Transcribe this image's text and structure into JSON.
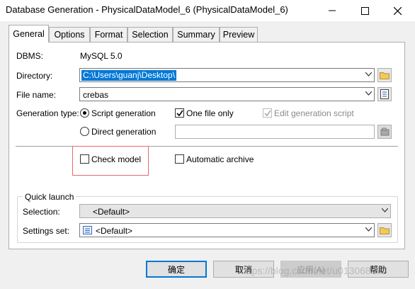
{
  "window": {
    "title": "Database Generation - PhysicalDataModel_6 (PhysicalDataModel_6)"
  },
  "tabs": [
    "General",
    "Options",
    "Format",
    "Selection",
    "Summary",
    "Preview"
  ],
  "general": {
    "dbms_label": "DBMS:",
    "dbms_value": "MySQL 5.0",
    "directory_label": "Directory:",
    "directory_value": "C:\\Users\\guanj\\Desktop\\",
    "filename_label": "File name:",
    "filename_value": "crebas",
    "gentype_label": "Generation type:",
    "script_generation": "Script generation",
    "direct_generation": "Direct generation",
    "one_file_only": "One file only",
    "edit_generation_script": "Edit generation script",
    "check_model": "Check model",
    "automatic_archive": "Automatic archive"
  },
  "quick_launch": {
    "group_label": "Quick launch",
    "selection_label": "Selection:",
    "selection_value": "<Default>",
    "settings_label": "Settings set:",
    "settings_value": "<Default>"
  },
  "buttons": {
    "ok": "确定",
    "cancel": "取消",
    "apply": "应用(A)",
    "help": "帮助"
  },
  "watermark": "https://blog.csdn.net/u013068898",
  "colors": {
    "highlight": "#0078d7",
    "annotation": "#e8686a",
    "default_button": "#0078d7"
  }
}
